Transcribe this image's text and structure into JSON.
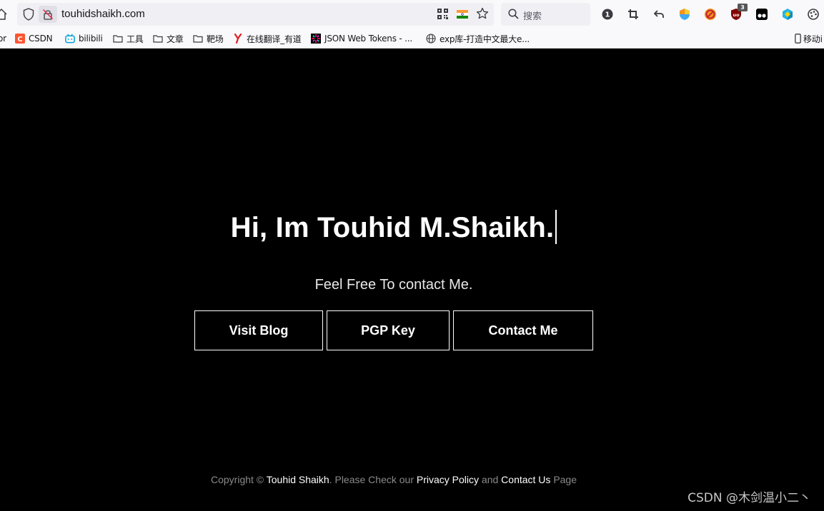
{
  "browser": {
    "url": "touhidshaikh.com",
    "search_placeholder": "搜索",
    "extension_badge": "3"
  },
  "bookmarks": [
    {
      "label": "or"
    },
    {
      "label": "CSDN"
    },
    {
      "label": "bilibili"
    },
    {
      "label": "工具"
    },
    {
      "label": "文章"
    },
    {
      "label": "靶场"
    },
    {
      "label": "在线翻译_有道"
    },
    {
      "label": "JSON Web Tokens - ..."
    },
    {
      "label": "exp库-打造中文最大e..."
    },
    {
      "label": "移动i"
    }
  ],
  "hero": {
    "title": "Hi, Im Touhid M.Shaikh.",
    "subtitle": "Feel Free To contact Me."
  },
  "buttons": {
    "blog": "Visit Blog",
    "pgp": "PGP Key",
    "contact": "Contact Me"
  },
  "footer": {
    "prefix": "Copyright ©",
    "author": "Touhid Shaikh",
    "middle": ". Please Check our",
    "privacy": "Privacy Policy",
    "and": "and",
    "contact": "Contact Us",
    "suffix": "Page"
  },
  "watermark": "CSDN @木剑温小二丶",
  "colors": {
    "page_bg": "#000000",
    "chrome_bg": "#f9f9fb",
    "urlbar_bg": "#f0f0f4",
    "csdn_red": "#fc5531",
    "bilibili_blue": "#00a1d6",
    "youdao_red": "#e31e24"
  }
}
